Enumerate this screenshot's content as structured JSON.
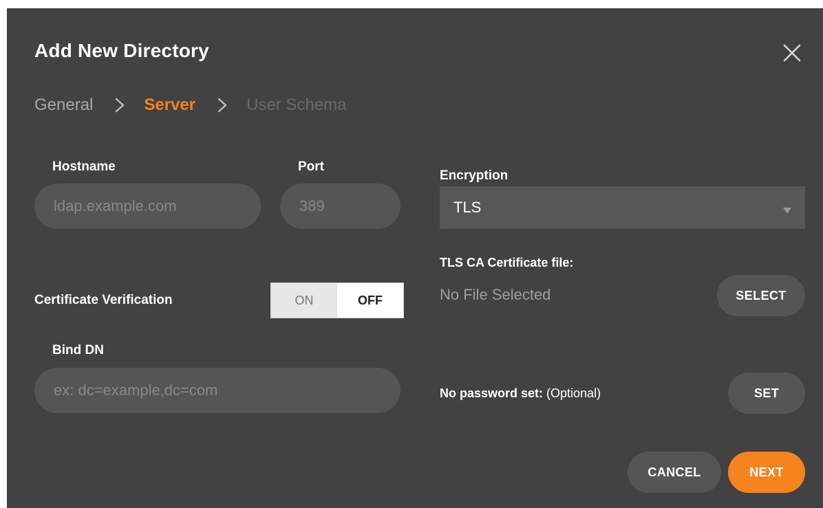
{
  "dialog": {
    "title": "Add New Directory",
    "close_icon": "close-icon"
  },
  "breadcrumb": {
    "steps": [
      "General",
      "Server",
      "User Schema"
    ],
    "active": "Server"
  },
  "form": {
    "hostname": {
      "label": "Hostname",
      "value": "",
      "placeholder": "ldap.example.com"
    },
    "port": {
      "label": "Port",
      "value": "",
      "placeholder": "389"
    },
    "certificate_verification": {
      "label": "Certificate Verification",
      "on_label": "ON",
      "off_label": "OFF",
      "selected": "OFF"
    },
    "bind_dn": {
      "label": "Bind DN",
      "value": "",
      "placeholder": "ex: dc=example,dc=com"
    },
    "encryption": {
      "label": "Encryption",
      "value": "TLS"
    },
    "tls_ca": {
      "label": "TLS CA Certificate file:",
      "status": "No File Selected",
      "button": "SELECT"
    },
    "password": {
      "status_bold": "No password set:",
      "status_note": " (Optional)",
      "button": "SET"
    }
  },
  "footer": {
    "cancel_label": "CANCEL",
    "next_label": "NEXT"
  },
  "colors": {
    "background": "#424242",
    "accent": "#f5841f",
    "field": "#555555"
  }
}
